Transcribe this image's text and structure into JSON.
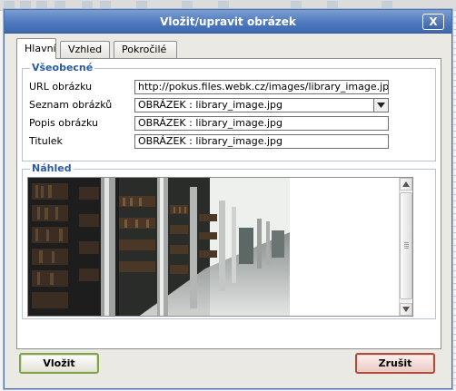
{
  "dialog": {
    "title": "Vložit/upravit obrázek",
    "close_label": "X"
  },
  "tabs": [
    {
      "label": "Hlavní",
      "active": true
    },
    {
      "label": "Vzhled",
      "active": false
    },
    {
      "label": "Pokročilé",
      "active": false
    }
  ],
  "general": {
    "legend": "Všeobecné",
    "url_label": "URL obrázku",
    "url_value": "http://pokus.files.webk.cz/images/library_image.jpg",
    "list_label": "Seznam obrázků",
    "list_selected": "OBRÁZEK : library_image.jpg",
    "description_label": "Popis obrázku",
    "description_value": "OBRÁZEK : library_image.jpg",
    "title_label": "Titulek",
    "title_value": "OBRÁZEK : library_image.jpg"
  },
  "preview": {
    "legend": "Náhled"
  },
  "buttons": {
    "insert": "Vložit",
    "cancel": "Zrušit"
  },
  "icons": {
    "close": "close-icon",
    "dropdown": "chevron-down-icon",
    "scroll_up": "arrow-up-icon",
    "scroll_down": "arrow-down-icon"
  },
  "colors": {
    "titlebar": "#4f7abf",
    "legend_text": "#2a5aa1",
    "insert_border": "#7fa24b",
    "cancel_border": "#b04a3a"
  }
}
